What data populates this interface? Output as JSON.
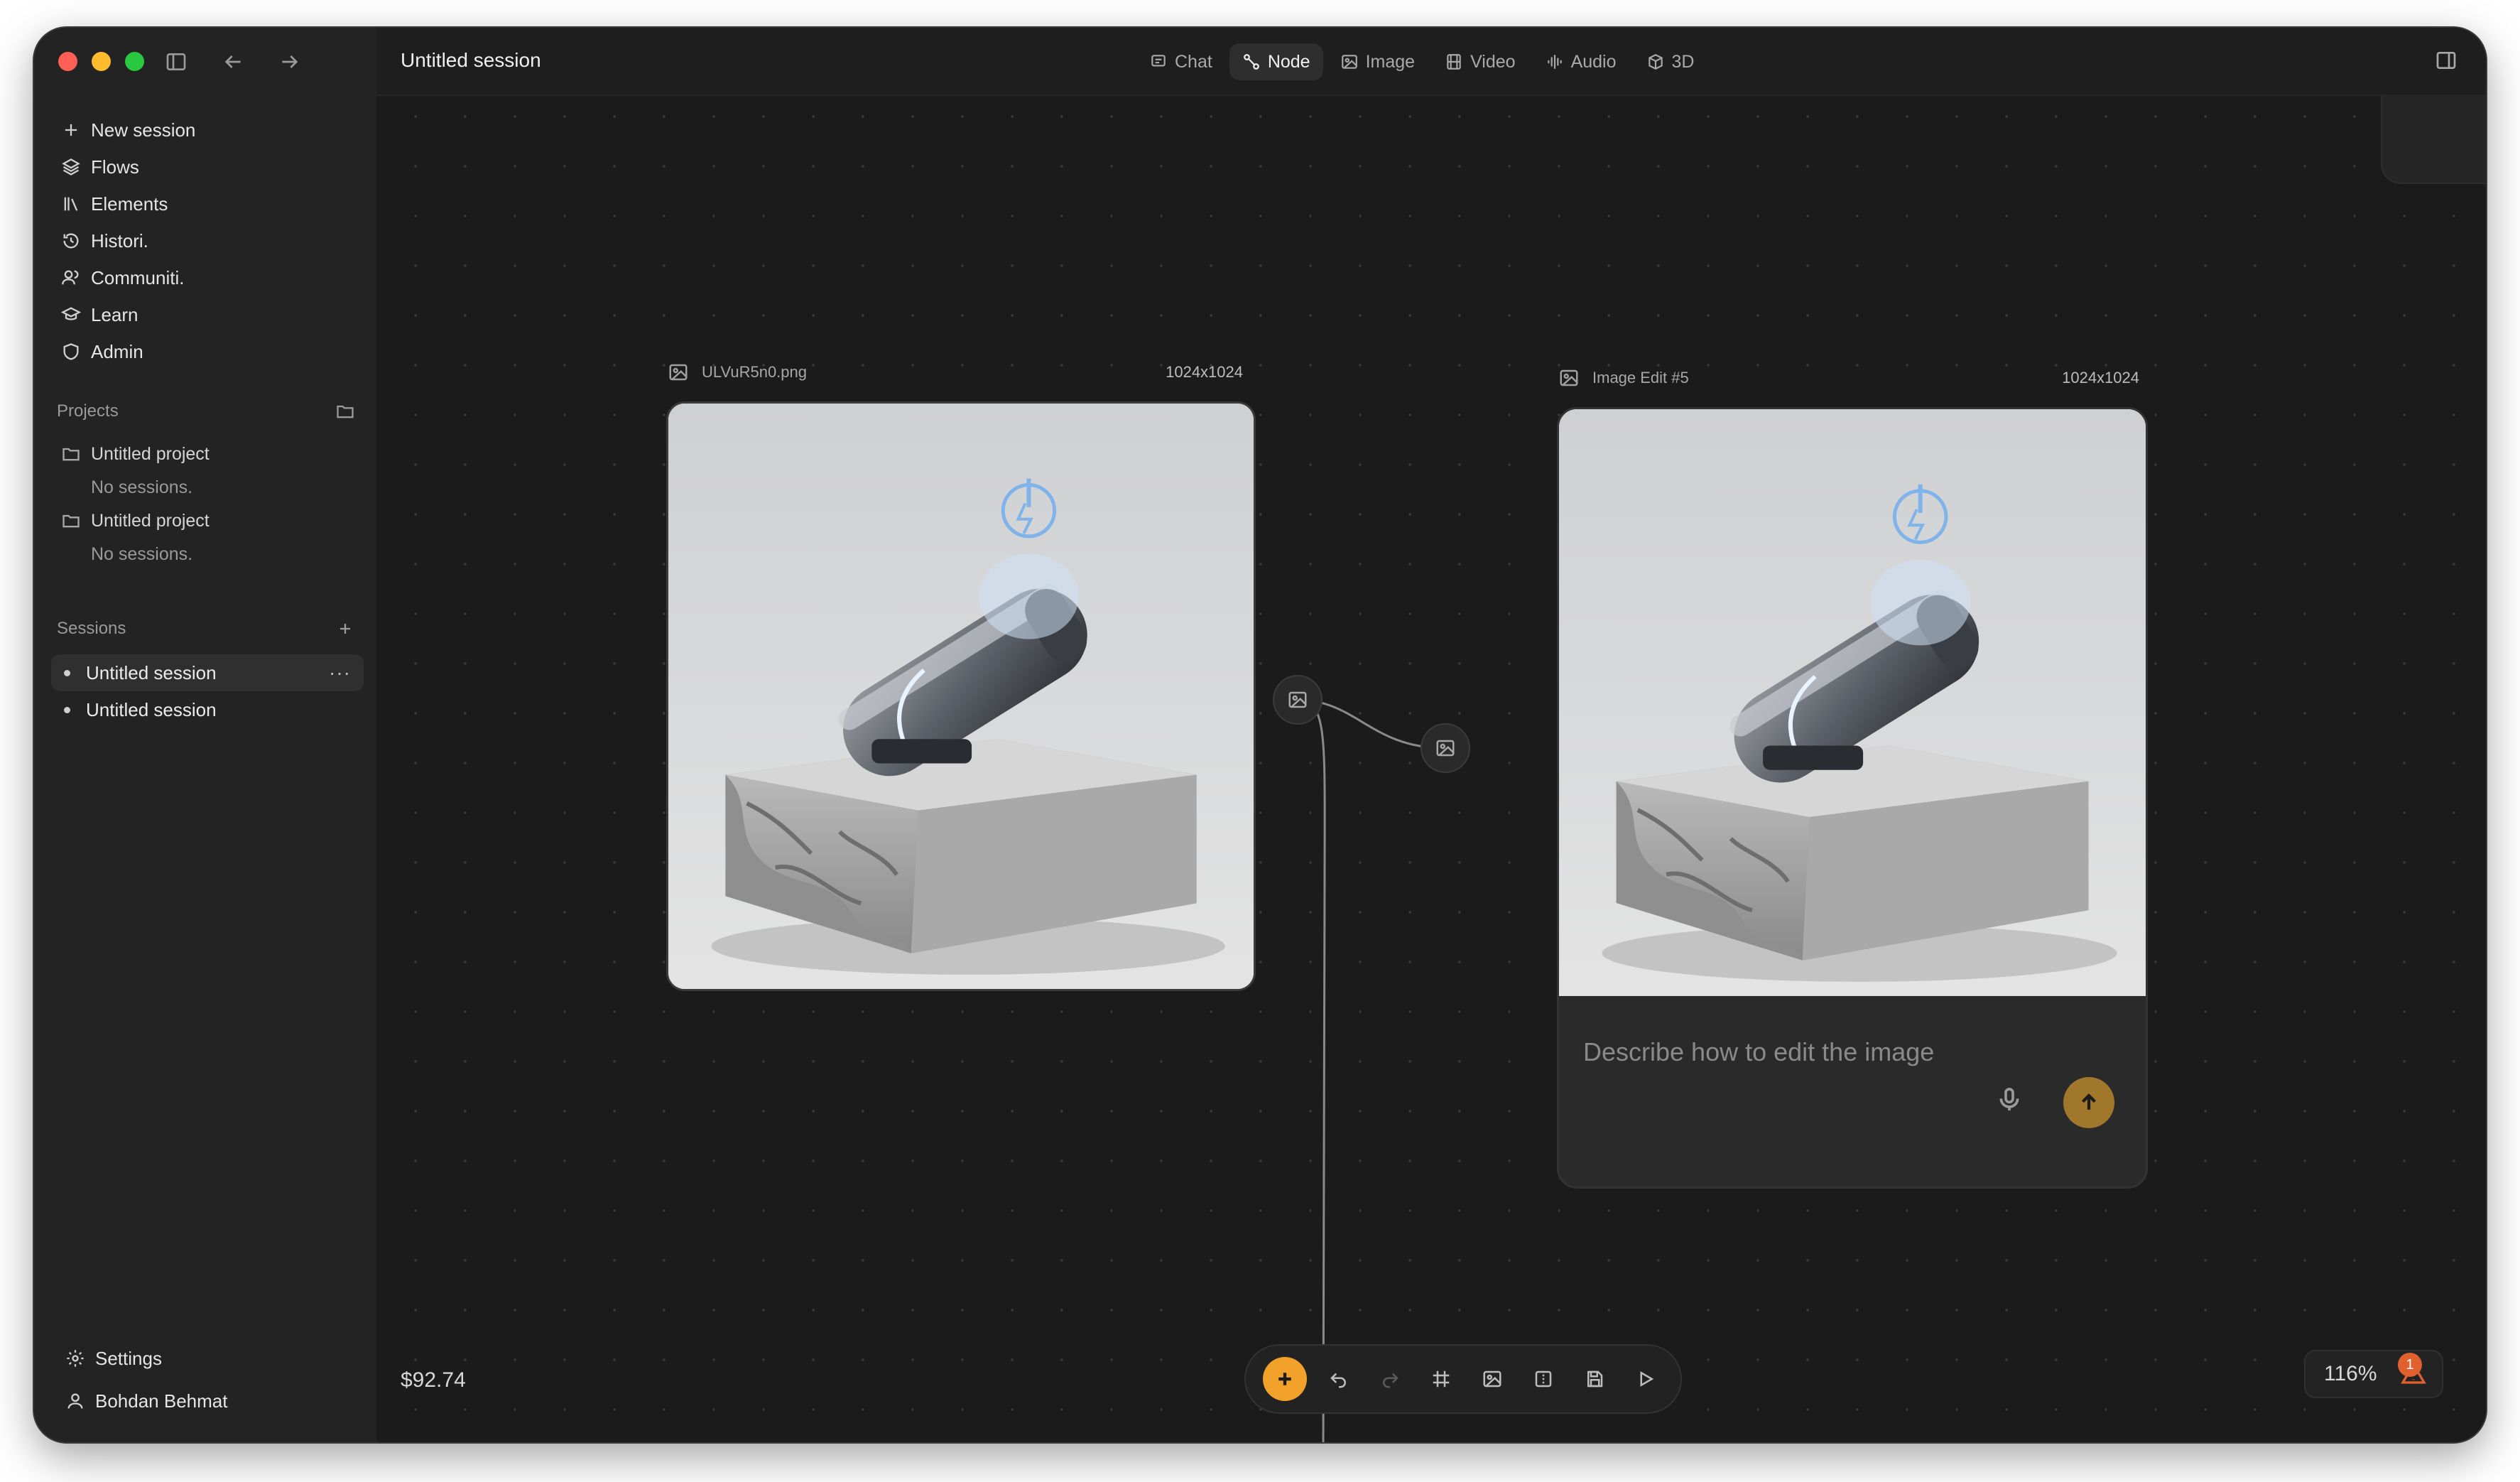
{
  "sidebar": {
    "nav": [
      {
        "label": "New session",
        "icon": "plus-icon"
      },
      {
        "label": "Flows",
        "icon": "layers-icon"
      },
      {
        "label": "Elements",
        "icon": "library-icon"
      },
      {
        "label": "Histori.",
        "icon": "history-icon"
      },
      {
        "label": "Communiti.",
        "icon": "users-icon"
      },
      {
        "label": "Learn",
        "icon": "graduation-cap-icon"
      },
      {
        "label": "Admin",
        "icon": "shield-icon"
      }
    ],
    "projects_label": "Projects",
    "projects": [
      {
        "name": "Untitled project",
        "empty": "No sessions."
      },
      {
        "name": "Untitled project",
        "empty": "No sessions."
      }
    ],
    "sessions_label": "Sessions",
    "sessions": [
      {
        "name": "Untitled session",
        "active": true,
        "more": "···"
      },
      {
        "name": "Untitled session",
        "active": false
      }
    ],
    "settings_label": "Settings",
    "user_name": "Bohdan Behmat"
  },
  "header": {
    "session_title": "Untitled session",
    "tabs": [
      {
        "label": "Chat",
        "icon": "chat-icon",
        "active": false
      },
      {
        "label": "Node",
        "icon": "node-icon",
        "active": true
      },
      {
        "label": "Image",
        "icon": "image-icon",
        "active": false
      },
      {
        "label": "Video",
        "icon": "film-icon",
        "active": false
      },
      {
        "label": "Audio",
        "icon": "audio-wave-icon",
        "active": false
      },
      {
        "label": "3D",
        "icon": "cube-icon",
        "active": false
      }
    ]
  },
  "canvas": {
    "source_node": {
      "title": "ULVuR5n0.png",
      "dimensions": "1024x1024"
    },
    "edit_node": {
      "title": "Image Edit #5",
      "dimensions": "1024x1024",
      "prompt_placeholder": "Describe how to edit the image"
    },
    "balance": "$92.74",
    "zoom": "116%",
    "warning_count": "1"
  },
  "colors": {
    "accent": "#f2a12a",
    "send_button": "#a1772b",
    "warning": "#e0602e"
  }
}
